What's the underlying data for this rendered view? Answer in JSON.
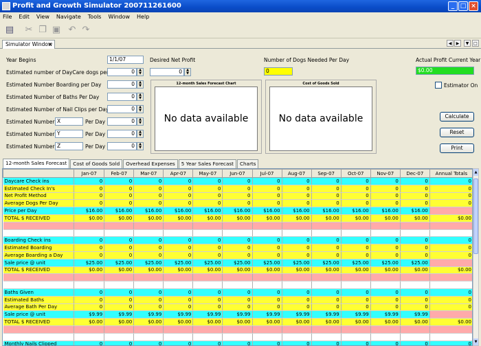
{
  "window": {
    "title": "Profit and Growth Simulator 200711261600"
  },
  "menu": [
    "File",
    "Edit",
    "View",
    "Navigate",
    "Tools",
    "Window",
    "Help"
  ],
  "tab": {
    "label": "Simulator Window",
    "close": "×"
  },
  "form": {
    "year_begins_label": "Year Begins",
    "year_begins_value": "1/1/07",
    "daycare_label": "Estimated number of DayCare dogs per day",
    "daycare_value": "0",
    "boarding_label": "Estimated Number Boarding per Day",
    "boarding_value": "0",
    "baths_label": "Estimated Number of Baths Per Day",
    "baths_value": "0",
    "nailclips_label": "Estimated Number of Nail Clips per Day",
    "nailclips_value": "0",
    "custom": [
      {
        "prefix": "Estimated Number of",
        "name": "X",
        "suffix": "Per Day",
        "value": "0"
      },
      {
        "prefix": "Estimated Number of",
        "name": "Y",
        "suffix": "Per Day",
        "value": "0"
      },
      {
        "prefix": "Estimated Number of",
        "name": "Z",
        "suffix": "Per Day",
        "value": "0"
      }
    ],
    "desired_profit_label": "Desired Net Profit",
    "desired_profit_value": "0",
    "dogs_needed_label": "Number of Dogs Needed Per Day",
    "dogs_needed_value": "0",
    "actual_profit_label": "Actual Profit Current Year",
    "actual_profit_value": "$0.00",
    "estimator_label": "Estimator On"
  },
  "charts": [
    {
      "title": "12-month Sales Forecast Chart",
      "message": "No data available"
    },
    {
      "title": "Cost of Goods Sold",
      "message": "No data available"
    }
  ],
  "buttons": {
    "calculate": "Calculate",
    "reset": "Reset",
    "print": "Print"
  },
  "subtabs": [
    "12-month Sales Forecast",
    "Cost of Goods Sold",
    "Overhead Expenses",
    "5 Year Sales Forecast",
    "Charts"
  ],
  "table": {
    "headers": [
      "",
      "Jan-07",
      "Feb-07",
      "Mar-07",
      "Apr-07",
      "May-07",
      "Jun-07",
      "Jul-07",
      "Aug-07",
      "Sep-07",
      "Oct-07",
      "Nov-07",
      "Dec-07",
      "Annual Totals"
    ],
    "rows": [
      {
        "style": "cyan",
        "cells": [
          "Daycare Check ins",
          "0",
          "0",
          "0",
          "0",
          "0",
          "0",
          "0",
          "0",
          "0",
          "0",
          "0",
          "0",
          "0"
        ]
      },
      {
        "style": "yellow",
        "cells": [
          "Estimated Check In's",
          "0",
          "0",
          "0",
          "0",
          "0",
          "0",
          "0",
          "0",
          "0",
          "0",
          "0",
          "0",
          "0"
        ]
      },
      {
        "style": "yellow",
        "cells": [
          "Net Profit Method",
          "0",
          "0",
          "0",
          "0",
          "0",
          "0",
          "0",
          "0",
          "0",
          "0",
          "0",
          "0",
          "0"
        ]
      },
      {
        "style": "yellow",
        "cells": [
          "Average Dogs Per Day",
          "0",
          "0",
          "0",
          "0",
          "0",
          "0",
          "0",
          "0",
          "0",
          "0",
          "0",
          "0",
          "0"
        ]
      },
      {
        "style": "cyan",
        "tot": true,
        "cells": [
          "Price per Day",
          "$16.00",
          "$16.00",
          "$16.00",
          "$16.00",
          "$16.00",
          "$16.00",
          "$16.00",
          "$16.00",
          "$16.00",
          "$16.00",
          "$16.00",
          "$16.00",
          ""
        ]
      },
      {
        "style": "yellow",
        "cells": [
          "TOTAL $ RECEIVED",
          "$0.00",
          "$0.00",
          "$0.00",
          "$0.00",
          "$0.00",
          "$0.00",
          "$0.00",
          "$0.00",
          "$0.00",
          "$0.00",
          "$0.00",
          "$0.00",
          "$0.00"
        ]
      },
      {
        "style": "pink",
        "cells": [
          "",
          "",
          "",
          "",
          "",
          "",
          "",
          "",
          "",
          "",
          "",
          "",
          "",
          ""
        ]
      },
      {
        "style": "white",
        "cells": [
          "",
          "",
          "",
          "",
          "",
          "",
          "",
          "",
          "",
          "",
          "",
          "",
          "",
          ""
        ]
      },
      {
        "style": "cyan",
        "cells": [
          "Boarding Check ins",
          "0",
          "0",
          "0",
          "0",
          "0",
          "0",
          "0",
          "0",
          "0",
          "0",
          "0",
          "0",
          "0"
        ]
      },
      {
        "style": "yellow",
        "cells": [
          "Estimated Boarding",
          "0",
          "0",
          "0",
          "0",
          "0",
          "0",
          "0",
          "0",
          "0",
          "0",
          "0",
          "0",
          "0"
        ]
      },
      {
        "style": "yellow",
        "cells": [
          "Average Boarding a Day",
          "0",
          "0",
          "0",
          "0",
          "0",
          "0",
          "0",
          "0",
          "0",
          "0",
          "0",
          "0",
          "0"
        ]
      },
      {
        "style": "cyan",
        "tot": true,
        "cells": [
          "Sale price @ unit",
          "$25.00",
          "$25.00",
          "$25.00",
          "$25.00",
          "$25.00",
          "$25.00",
          "$25.00",
          "$25.00",
          "$25.00",
          "$25.00",
          "$25.00",
          "$25.00",
          ""
        ]
      },
      {
        "style": "yellow",
        "cells": [
          "TOTAL $ RECEIVED",
          "$0.00",
          "$0.00",
          "$0.00",
          "$0.00",
          "$0.00",
          "$0.00",
          "$0.00",
          "$0.00",
          "$0.00",
          "$0.00",
          "$0.00",
          "$0.00",
          "$0.00"
        ]
      },
      {
        "style": "pink",
        "cells": [
          "",
          "",
          "",
          "",
          "",
          "",
          "",
          "",
          "",
          "",
          "",
          "",
          "",
          ""
        ]
      },
      {
        "style": "white",
        "cells": [
          "",
          "",
          "",
          "",
          "",
          "",
          "",
          "",
          "",
          "",
          "",
          "",
          "",
          ""
        ]
      },
      {
        "style": "cyan",
        "cells": [
          "Baths Given",
          "0",
          "0",
          "0",
          "0",
          "0",
          "0",
          "0",
          "0",
          "0",
          "0",
          "0",
          "0",
          "0"
        ]
      },
      {
        "style": "yellow",
        "cells": [
          "Estimated Baths",
          "0",
          "0",
          "0",
          "0",
          "0",
          "0",
          "0",
          "0",
          "0",
          "0",
          "0",
          "0",
          "0"
        ]
      },
      {
        "style": "yellow",
        "cells": [
          "Average Bath Per Day",
          "0",
          "0",
          "0",
          "0",
          "0",
          "0",
          "0",
          "0",
          "0",
          "0",
          "0",
          "0",
          "0"
        ]
      },
      {
        "style": "cyan",
        "tot": true,
        "cells": [
          "Sale price @ unit",
          "$9.99",
          "$9.99",
          "$9.99",
          "$9.99",
          "$9.99",
          "$9.99",
          "$9.99",
          "$9.99",
          "$9.99",
          "$9.99",
          "$9.99",
          "$9.99",
          ""
        ]
      },
      {
        "style": "yellow",
        "cells": [
          "TOTAL $ RECEIVED",
          "$0.00",
          "$0.00",
          "$0.00",
          "$0.00",
          "$0.00",
          "$0.00",
          "$0.00",
          "$0.00",
          "$0.00",
          "$0.00",
          "$0.00",
          "$0.00",
          "$0.00"
        ]
      },
      {
        "style": "pink",
        "cells": [
          "",
          "",
          "",
          "",
          "",
          "",
          "",
          "",
          "",
          "",
          "",
          "",
          "",
          ""
        ]
      },
      {
        "style": "white",
        "cells": [
          "",
          "",
          "",
          "",
          "",
          "",
          "",
          "",
          "",
          "",
          "",
          "",
          "",
          ""
        ]
      },
      {
        "style": "cyan",
        "cells": [
          "Monthly Nails Clipped",
          "0",
          "0",
          "0",
          "0",
          "0",
          "0",
          "0",
          "0",
          "0",
          "0",
          "0",
          "0",
          "0"
        ]
      }
    ]
  }
}
